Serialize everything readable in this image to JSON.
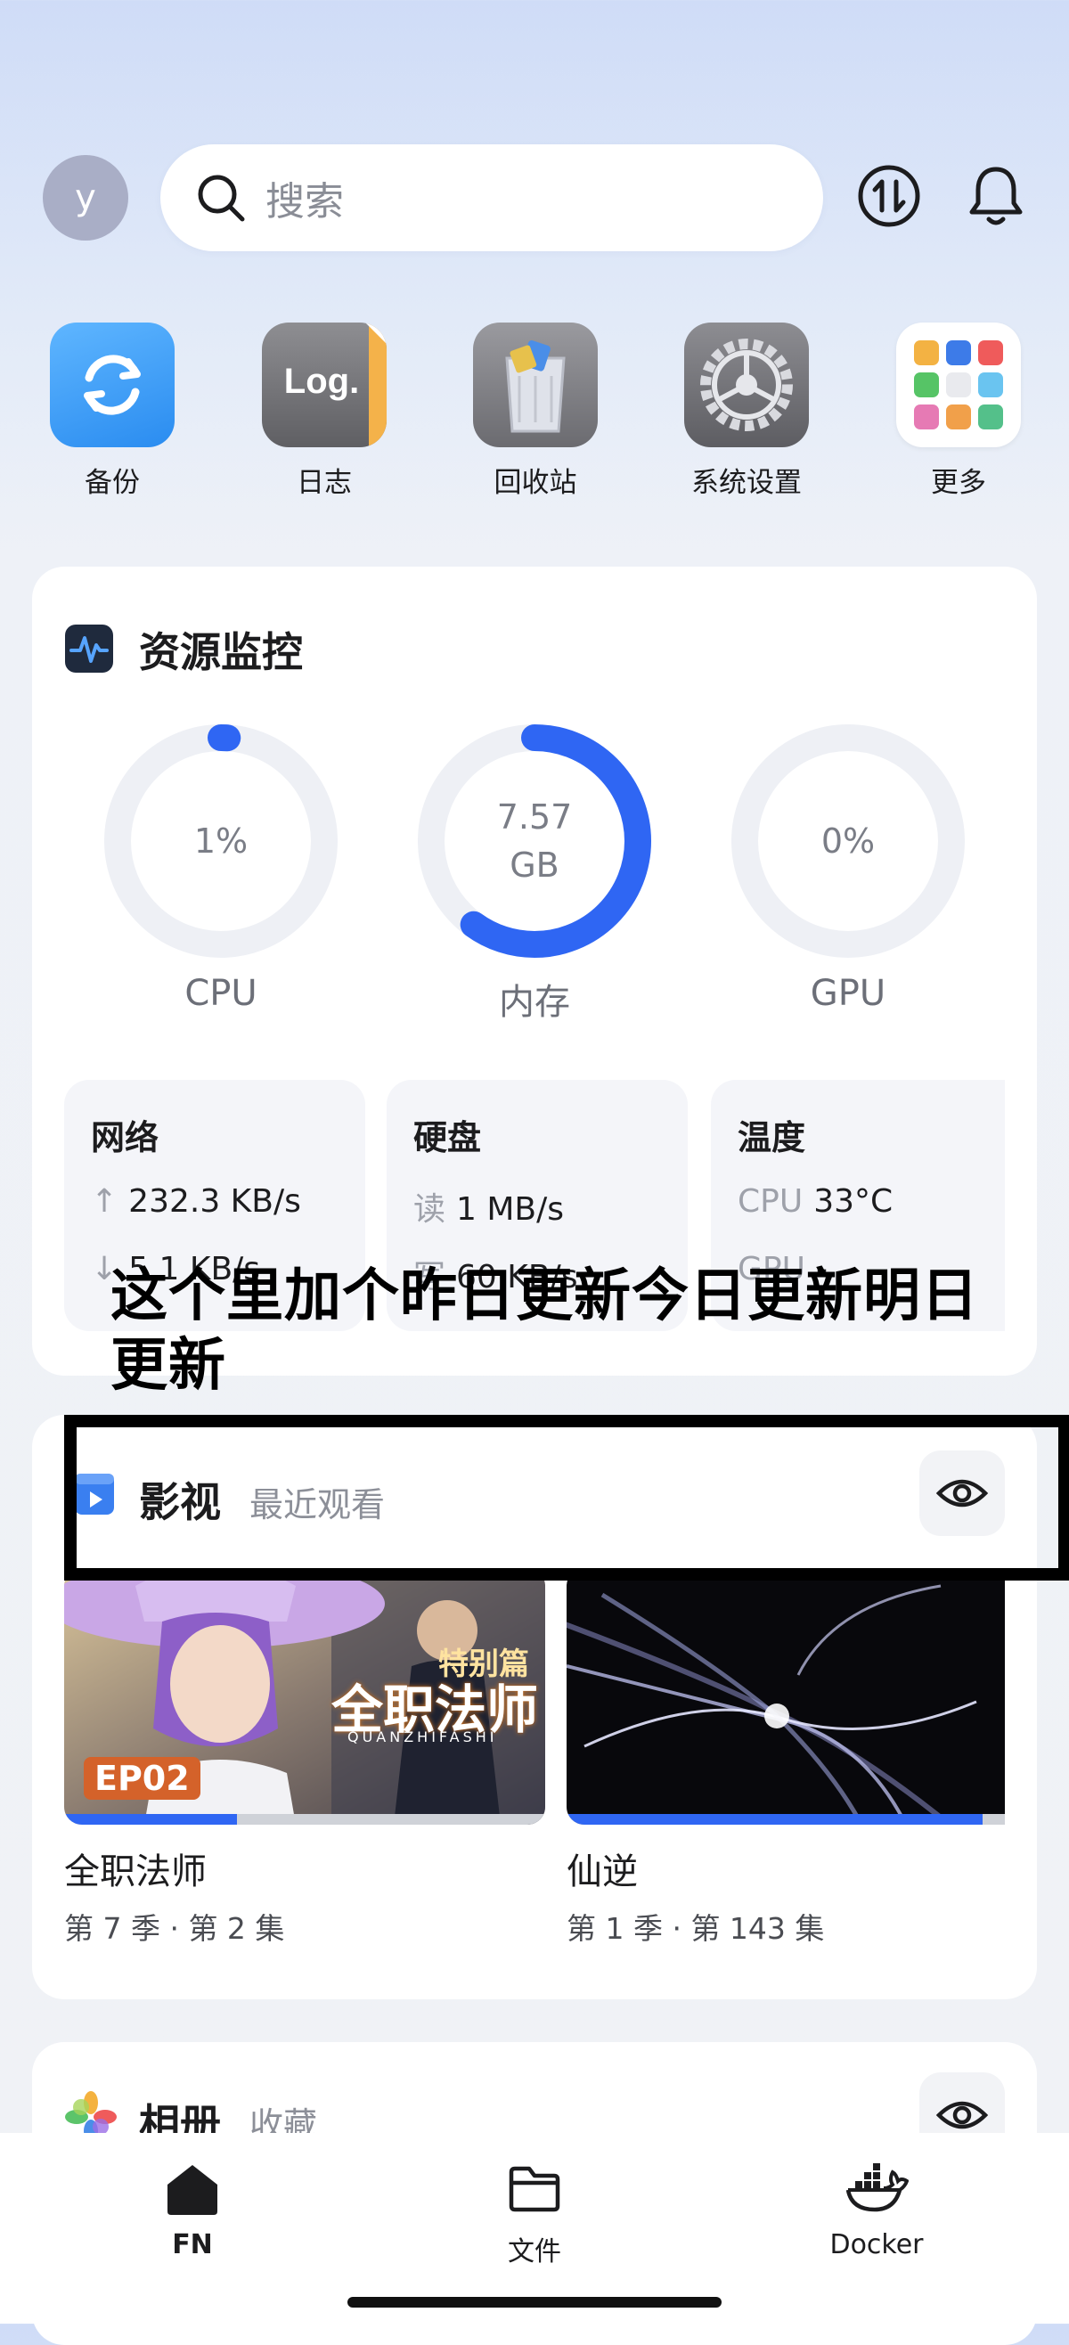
{
  "header": {
    "avatar_letter": "y",
    "search_placeholder": "搜索"
  },
  "apps": [
    {
      "label": "备份",
      "icon": "backup-sync-icon"
    },
    {
      "label": "日志",
      "icon": "log-icon",
      "icon_text": "Log."
    },
    {
      "label": "回收站",
      "icon": "trash-bin-icon"
    },
    {
      "label": "系统设置",
      "icon": "gear-icon"
    },
    {
      "label": "更多",
      "icon": "apps-grid-icon"
    }
  ],
  "monitor": {
    "title": "资源监控",
    "gauges": [
      {
        "label": "CPU",
        "value_line1": "1%",
        "value_line2": "",
        "fraction": 0.01
      },
      {
        "label": "内存",
        "value_line1": "7.57",
        "value_line2": "GB",
        "fraction": 0.6
      },
      {
        "label": "GPU",
        "value_line1": "0%",
        "value_line2": "",
        "fraction": 0
      }
    ],
    "stats": [
      {
        "title": "网络",
        "row1_key": "↑",
        "row1_val": "232.3 KB/s",
        "row2_key": "↓",
        "row2_val": "5.1 KB/s"
      },
      {
        "title": "硬盘",
        "row1_key": "读",
        "row1_val": "1 MB/s",
        "row2_key": "写",
        "row2_val": "60 KB/s"
      },
      {
        "title": "温度",
        "row1_key": "CPU",
        "row1_val": "33°C",
        "row2_key": "GPU",
        "row2_val": "-"
      }
    ]
  },
  "annotation": {
    "text": "这个里加个昨日更新今日更新明日更新"
  },
  "video": {
    "title": "影视",
    "subtitle": "最近观看",
    "items": [
      {
        "title": "全职法师",
        "episode": "第 7 季 · 第 2 集",
        "progress": 0.36,
        "badge": "EP02",
        "thumb_text_top": "特别篇",
        "thumb_text_main": "全职法师",
        "thumb_text_pinyin": "QUANZHIFASHI"
      },
      {
        "title": "仙逆",
        "episode": "第 1 季 · 第 143 集",
        "progress": 0.95
      }
    ]
  },
  "photos": {
    "title": "相册",
    "subtitle": "收藏"
  },
  "tabbar": [
    {
      "label": "FN",
      "active": true
    },
    {
      "label": "文件",
      "active": false
    },
    {
      "label": "Docker",
      "active": false
    }
  ],
  "colors": {
    "accent": "#2f66f3",
    "ring_track": "#eef0f5"
  }
}
